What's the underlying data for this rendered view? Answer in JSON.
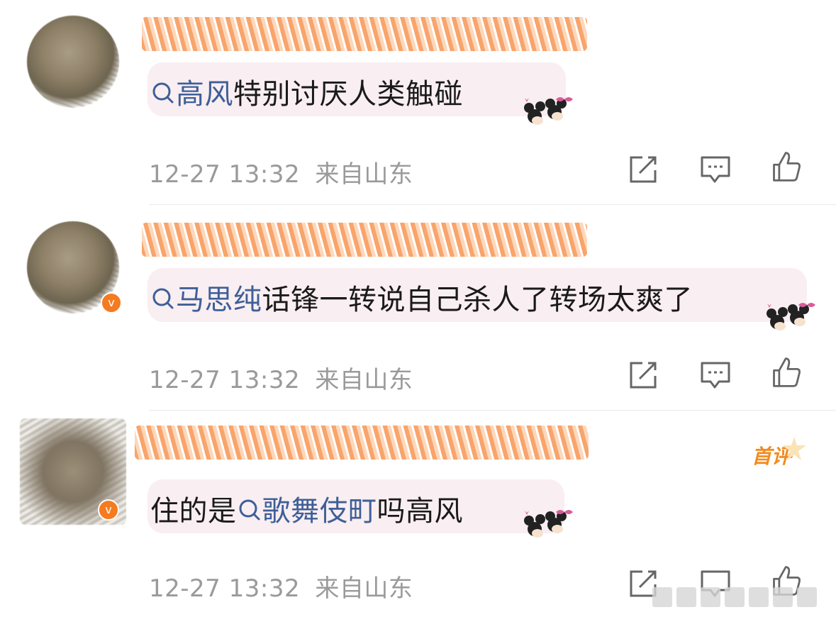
{
  "comments": [
    {
      "content_prefix": "",
      "topic": "高风",
      "content_suffix": "特别讨厌人类触碰",
      "time": "12-27 13:32",
      "location": "来自山东",
      "first_badge": ""
    },
    {
      "content_prefix": "",
      "topic": "马思纯",
      "content_suffix": "话锋一转说自己杀人了转场太爽了",
      "time": "12-27 13:32",
      "location": "来自山东",
      "first_badge": ""
    },
    {
      "content_prefix": "住的是",
      "topic": "歌舞伎町",
      "content_suffix": "吗高风",
      "time": "12-27 13:32",
      "location": "来自山东",
      "first_badge": "首评"
    }
  ],
  "icons": {
    "search": "search-icon",
    "share": "share-icon",
    "reply": "comment-icon",
    "like": "thumbs-up-icon"
  },
  "colors": {
    "topic_link": "#3e5f98",
    "meta_text": "#9a9a9a",
    "bubble": "#f9eef1",
    "verify_badge": "#f47b20",
    "first_badge": "#f28b1f"
  }
}
